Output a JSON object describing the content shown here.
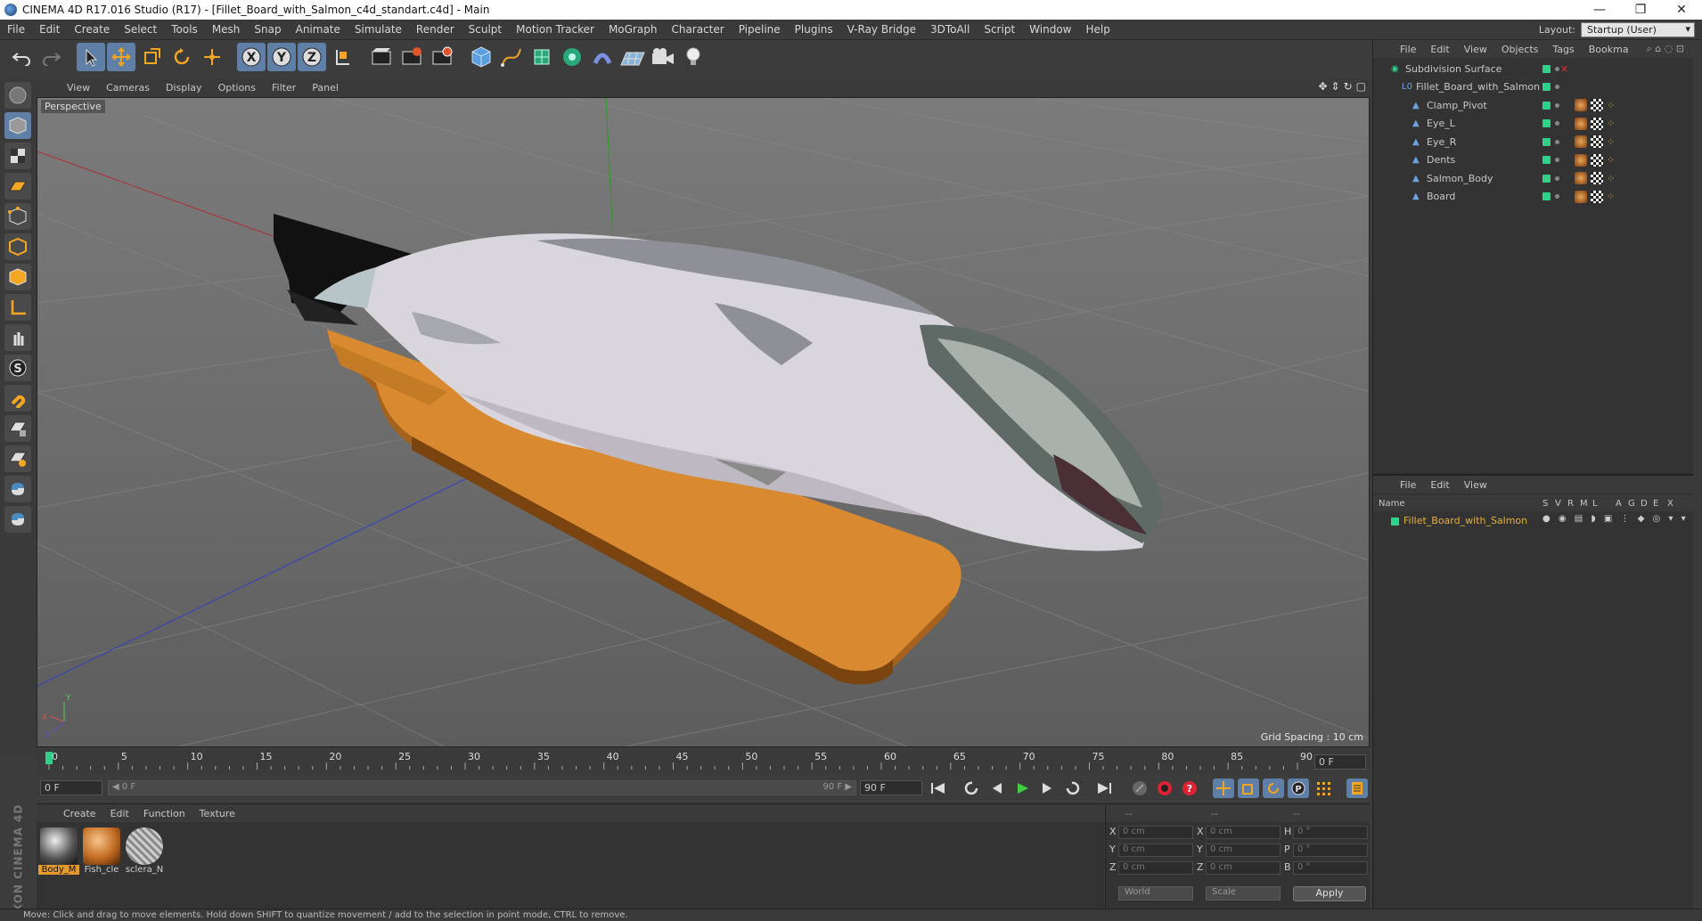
{
  "window": {
    "title": "CINEMA 4D R17.016 Studio (R17) - [Fillet_Board_with_Salmon_c4d_standart.c4d] - Main",
    "minimize": "—",
    "restore": "❐",
    "close": "✕"
  },
  "menubar": {
    "items": [
      "File",
      "Edit",
      "Create",
      "Select",
      "Tools",
      "Mesh",
      "Snap",
      "Animate",
      "Simulate",
      "Render",
      "Sculpt",
      "Motion Tracker",
      "MoGraph",
      "Character",
      "Pipeline",
      "Plugins",
      "V-Ray Bridge",
      "3DToAll",
      "Script",
      "Window",
      "Help"
    ],
    "layout_label": "Layout:",
    "layout_value": "Startup (User)"
  },
  "viewport": {
    "menu": [
      "View",
      "Cameras",
      "Display",
      "Options",
      "Filter",
      "Panel"
    ],
    "label": "Perspective",
    "grid_spacing": "Grid Spacing : 10 cm"
  },
  "timeline": {
    "ticks": [
      "0",
      "5",
      "10",
      "15",
      "20",
      "25",
      "30",
      "35",
      "40",
      "45",
      "50",
      "55",
      "60",
      "65",
      "70",
      "75",
      "80",
      "85",
      "90"
    ],
    "current_frame_right": "0 F",
    "start_frame": "0 F",
    "range_start": "◀ 0 F",
    "range_end": "90 F ▶",
    "end_frame": "90 F"
  },
  "materials": {
    "menu": [
      "Create",
      "Edit",
      "Function",
      "Texture"
    ],
    "items": [
      {
        "name": "Body_M",
        "selected": true
      },
      {
        "name": "Fish_cle",
        "selected": false
      },
      {
        "name": "sclera_N",
        "selected": false
      }
    ]
  },
  "coordinates": {
    "headers": [
      "--",
      "--",
      "--"
    ],
    "rows": [
      {
        "a": "X",
        "av": "0 cm",
        "b": "X",
        "bv": "0 cm",
        "c": "H",
        "cv": "0 °"
      },
      {
        "a": "Y",
        "av": "0 cm",
        "b": "Y",
        "bv": "0 cm",
        "c": "P",
        "cv": "0 °"
      },
      {
        "a": "Z",
        "av": "0 cm",
        "b": "Z",
        "bv": "0 cm",
        "c": "B",
        "cv": "0 °"
      }
    ],
    "mode1": "World",
    "mode2": "Scale",
    "apply": "Apply"
  },
  "object_manager": {
    "menu": [
      "File",
      "Edit",
      "View",
      "Objects",
      "Tags",
      "Bookma"
    ],
    "objects": [
      {
        "name": "Subdivision Surface",
        "indent": 0
      },
      {
        "name": "Fillet_Board_with_Salmon",
        "indent": 1
      },
      {
        "name": "Clamp_Pivot",
        "indent": 2
      },
      {
        "name": "Eye_L",
        "indent": 2
      },
      {
        "name": "Eye_R",
        "indent": 2
      },
      {
        "name": "Dents",
        "indent": 2
      },
      {
        "name": "Salmon_Body",
        "indent": 2
      },
      {
        "name": "Board",
        "indent": 2
      }
    ]
  },
  "layer_manager": {
    "menu": [
      "File",
      "Edit",
      "View"
    ],
    "columns": [
      "Name",
      "S",
      "V",
      "R",
      "M",
      "L",
      "A",
      "G",
      "D",
      "E",
      "X"
    ],
    "rows": [
      {
        "name": "Fillet_Board_with_Salmon"
      }
    ]
  },
  "status": "Move: Click and drag to move elements. Hold down SHIFT to quantize movement / add to the selection in point mode, CTRL to remove.",
  "colors": {
    "accent": "#5f7fa6",
    "object_green": "#2fd08a",
    "selection_orange": "#e49a2d",
    "layer_name": "#e8b03c"
  }
}
